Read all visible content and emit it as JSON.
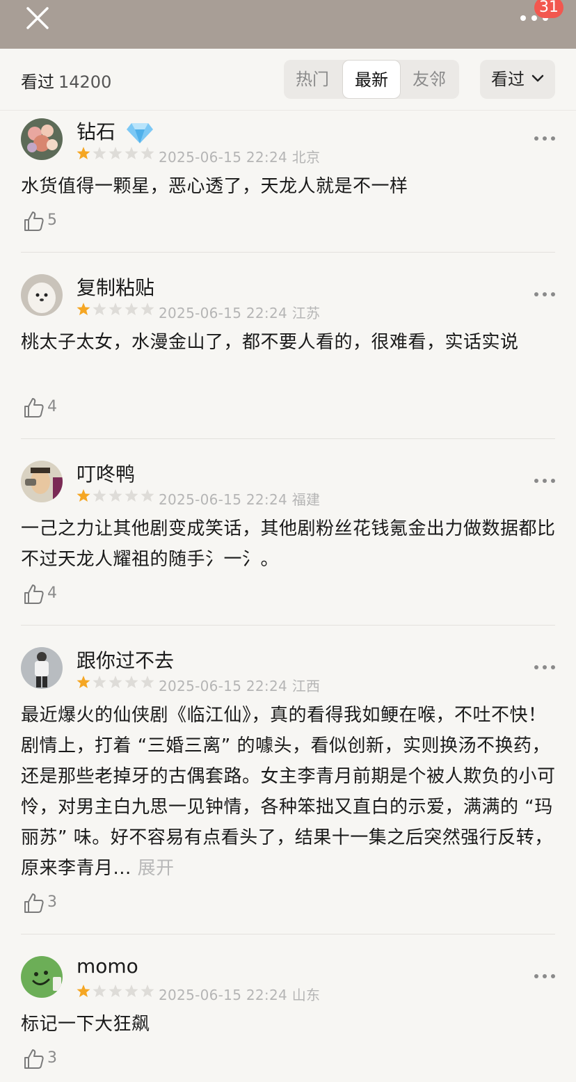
{
  "header": {
    "notification_count": "31",
    "close_icon": "close-icon",
    "more_icon": "more-horizontal-icon"
  },
  "filter": {
    "count_label": "看过",
    "count_value": "14200",
    "tabs": [
      {
        "label": "热门",
        "active": false
      },
      {
        "label": "最新",
        "active": true
      },
      {
        "label": "友邻",
        "active": false
      }
    ],
    "sort_label": "看过"
  },
  "reviews": [
    {
      "username": "钻石",
      "badge_icon": "diamond-icon",
      "rating": 1,
      "datetime": "2025-06-15 22:24",
      "location": "北京",
      "text": "水货值得一颗星，恶心透了，天龙人就是不一样",
      "likes": "5"
    },
    {
      "username": "复制粘贴",
      "rating": 1,
      "datetime": "2025-06-15 22:24",
      "location": "江苏",
      "text": "桃太子太女，水漫金山了，都不要人看的，很难看，实话实说",
      "likes": "4"
    },
    {
      "username": "叮咚鸭",
      "rating": 1,
      "datetime": "2025-06-15 22:24",
      "location": "福建",
      "text": "一己之力让其他剧变成笑话，其他剧粉丝花钱氪金出力做数据都比不过天龙人耀祖的随手氵一氵。",
      "likes": "4"
    },
    {
      "username": "跟你过不去",
      "rating": 1,
      "datetime": "2025-06-15 22:24",
      "location": "江西",
      "text": "最近爆火的仙侠剧《临江仙》，真的看得我如鲠在喉，不吐不快！剧情上，打着 “三婚三离” 的噱头，看似创新，实则换汤不换药，还是那些老掉牙的古偶套路。女主李青月前期是个被人欺负的小可怜，对男主白九思一见钟情，各种笨拙又直白的示爱，满满的 “玛丽苏” 味。好不容易有点看头了，结果十一集之后突然强行反转，原来李青月...",
      "expand_label": "展开",
      "likes": "3"
    },
    {
      "username": "momo",
      "rating": 1,
      "datetime": "2025-06-15 22:24",
      "location": "山东",
      "text": "标记一下大狂飙",
      "likes": "3"
    }
  ],
  "colors": {
    "star_filled": "#f5a623",
    "star_empty": "#dedcd8",
    "badge": "#f2574f",
    "header_bg": "#a89e96"
  }
}
